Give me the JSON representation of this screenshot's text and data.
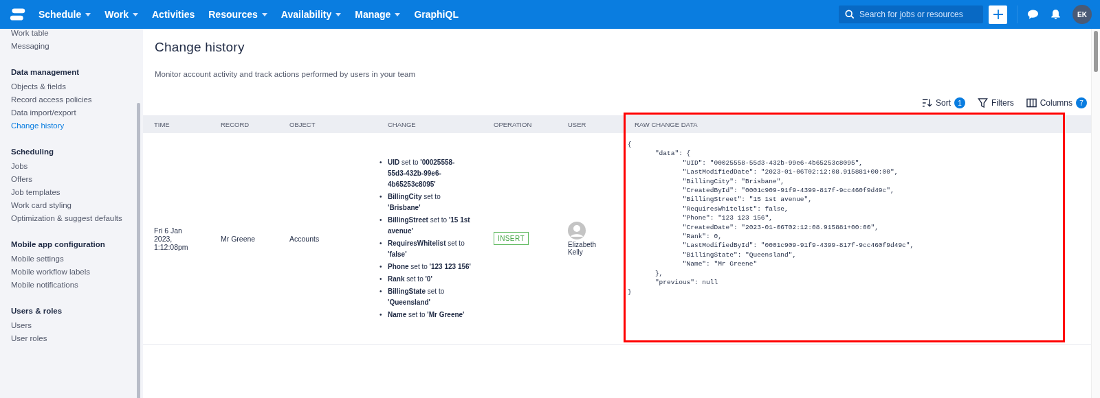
{
  "nav": {
    "items": [
      {
        "label": "Schedule",
        "dropdown": true
      },
      {
        "label": "Work",
        "dropdown": true
      },
      {
        "label": "Activities",
        "dropdown": false
      },
      {
        "label": "Resources",
        "dropdown": true
      },
      {
        "label": "Availability",
        "dropdown": true
      },
      {
        "label": "Manage",
        "dropdown": true
      },
      {
        "label": "GraphiQL",
        "dropdown": false
      }
    ],
    "search": {
      "placeholder": "Search for jobs or resources"
    },
    "avatar": "EK"
  },
  "sidebar": {
    "top_items": [
      {
        "label": "Work table",
        "selected": false
      },
      {
        "label": "Messaging",
        "selected": false
      }
    ],
    "sections": [
      {
        "title": "Data management",
        "items": [
          {
            "label": "Objects & fields",
            "selected": false
          },
          {
            "label": "Record access policies",
            "selected": false
          },
          {
            "label": "Data import/export",
            "selected": false
          },
          {
            "label": "Change history",
            "selected": true
          }
        ]
      },
      {
        "title": "Scheduling",
        "items": [
          {
            "label": "Jobs",
            "selected": false
          },
          {
            "label": "Offers",
            "selected": false
          },
          {
            "label": "Job templates",
            "selected": false
          },
          {
            "label": "Work card styling",
            "selected": false
          },
          {
            "label": "Optimization & suggest defaults",
            "selected": false
          }
        ]
      },
      {
        "title": "Mobile app configuration",
        "items": [
          {
            "label": "Mobile settings",
            "selected": false
          },
          {
            "label": "Mobile workflow labels",
            "selected": false
          },
          {
            "label": "Mobile notifications",
            "selected": false
          }
        ]
      },
      {
        "title": "Users & roles",
        "items": [
          {
            "label": "Users",
            "selected": false
          },
          {
            "label": "User roles",
            "selected": false
          }
        ]
      }
    ]
  },
  "page": {
    "title": "Change history",
    "subtitle": "Monitor account activity and track actions performed by users in your team"
  },
  "toolbar": {
    "sort": {
      "label": "Sort",
      "count": "1"
    },
    "filters": {
      "label": "Filters"
    },
    "columns": {
      "label": "Columns",
      "count": "7"
    }
  },
  "table": {
    "columns": [
      "TIME",
      "RECORD",
      "OBJECT",
      "CHANGE",
      "OPERATION",
      "USER",
      "RAW CHANGE DATA"
    ],
    "rows": [
      {
        "time": "Fri 6 Jan 2023, 1:12:08pm",
        "record": "Mr Greene",
        "object": "Accounts",
        "changes": [
          {
            "marker": "•",
            "text": "**UID** set to **'00025558-55d3-432b-99e6-4b65253c8095'**"
          },
          {
            "marker": "•",
            "text": "**BillingCity** set to **'Brisbane'**"
          },
          {
            "marker": "•",
            "text": "**BillingStreet** set to **'15 1st avenue'**"
          },
          {
            "marker": "•",
            "text": "**RequiresWhitelist** set to **'false'**"
          },
          {
            "marker": "•",
            "text": "**Phone** set to **'123 123 156'**"
          },
          {
            "marker": "•",
            "text": "**Rank** set to **'0'**"
          },
          {
            "marker": "•",
            "text": "**BillingState** set to **'Queensland'**"
          },
          {
            "marker": "•",
            "text": "**Name** set to **'Mr Greene'**"
          }
        ],
        "operation": "INSERT",
        "user": "Elizabeth Kelly",
        "highlighted": true,
        "raw": "{\n\t\"data\": {\n\t\t\"UID\": \"00025558-55d3-432b-99e6-4b65253c8095\",\n\t\t\"LastModifiedDate\": \"2023-01-06T02:12:08.915881+00:00\",\n\t\t\"BillingCity\": \"Brisbane\",\n\t\t\"CreatedById\": \"0001c909-91f9-4399-817f-9cc460f9d49c\",\n\t\t\"BillingStreet\": \"15 1st avenue\",\n\t\t\"RequiresWhitelist\": false,\n\t\t\"Phone\": \"123 123 156\",\n\t\t\"CreatedDate\": \"2023-01-06T02:12:08.915881+00:00\",\n\t\t\"Rank\": 0,\n\t\t\"LastModifiedById\": \"0001c909-91f9-4399-817f-9cc460f9d49c\",\n\t\t\"BillingState\": \"Queensland\",\n\t\t\"Name\": \"Mr Greene\"\n\t},\n\t\"previous\": null\n}"
      }
    ]
  }
}
